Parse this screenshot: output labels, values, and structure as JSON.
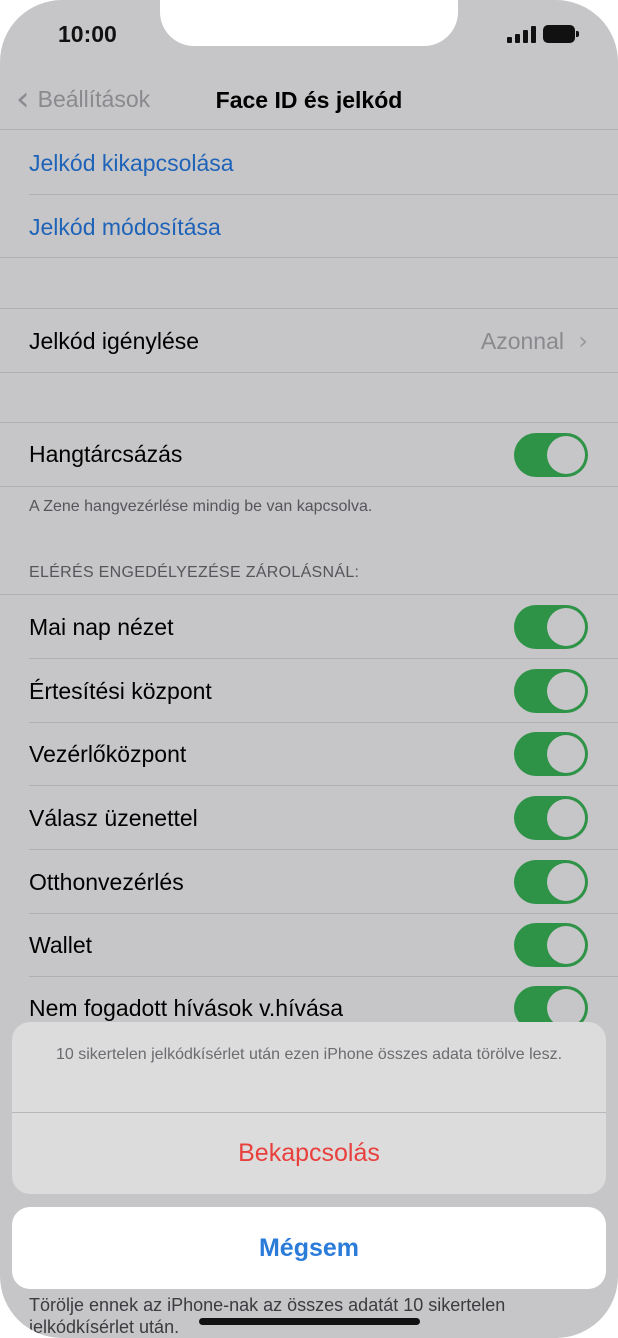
{
  "status": {
    "time": "10:00"
  },
  "nav": {
    "back_label": "Beállítások",
    "title": "Face ID és jelkód"
  },
  "passcode_links": {
    "turn_off": "Jelkód kikapcsolása",
    "change": "Jelkód módosítása"
  },
  "require_passcode": {
    "label": "Jelkód igénylése",
    "value": "Azonnal"
  },
  "voice_dial": {
    "label": "Hangtárcsázás",
    "on": true,
    "footnote": "A Zene hangvezérlése mindig be van kapcsolva."
  },
  "locked_access": {
    "header": "ELÉRÉS ENGEDÉLYEZÉSE ZÁROLÁSNÁL:",
    "items": [
      {
        "label": "Mai nap nézet",
        "on": true
      },
      {
        "label": "Értesítési központ",
        "on": true
      },
      {
        "label": "Vezérlőközpont",
        "on": true
      },
      {
        "label": "Válasz üzenettel",
        "on": true
      },
      {
        "label": "Otthonvezérlés",
        "on": true
      },
      {
        "label": "Wallet",
        "on": true
      },
      {
        "label": "Nem fogadott hívások v.hívása",
        "on": true
      }
    ]
  },
  "action_sheet": {
    "message": "10 sikertelen jelkódkísérlet után ezen iPhone összes adata törölve lesz.",
    "confirm_label": "Bekapcsolás",
    "cancel_label": "Mégsem"
  },
  "erase_footnote": "Törölje ennek az iPhone-nak az összes adatát 10 sikertelen jelkódkísérlet után.",
  "colors": {
    "toggle_on": "#2f9347",
    "link": "#1e63b8",
    "destructive": "#e8403c",
    "cancel": "#2b7bd9"
  }
}
